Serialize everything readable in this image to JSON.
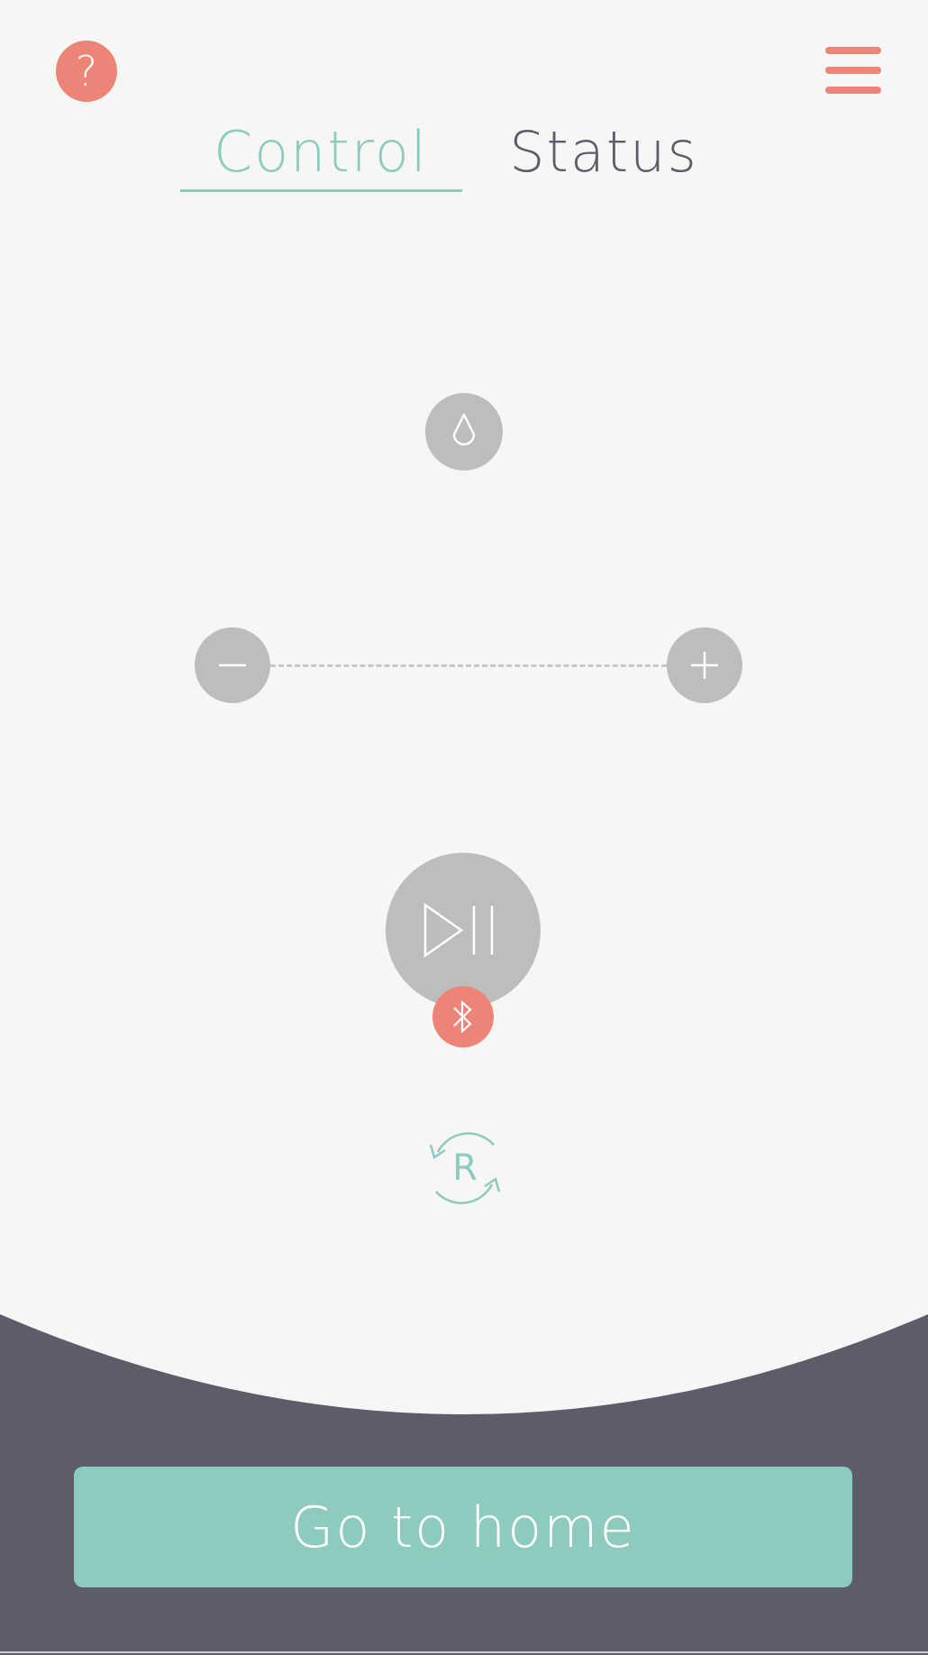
{
  "header": {
    "help_label": "?",
    "help_icon": "question-icon",
    "menu_icon": "hamburger-menu-icon"
  },
  "tabs": [
    {
      "label": "Control",
      "active": true
    },
    {
      "label": "Status",
      "active": false
    }
  ],
  "controls": {
    "drop_icon": "water-drop-icon",
    "decrease_icon": "minus-icon",
    "increase_icon": "plus-icon",
    "play_pause_icon": "play-pause-icon",
    "bluetooth_icon": "bluetooth-icon",
    "reset_label": "R",
    "reset_icon": "refresh-icon"
  },
  "footer": {
    "home_label": "Go to home"
  },
  "colors": {
    "background": "#f6f7f5",
    "accent": "#8ecbbf",
    "coral": "#ec8477",
    "button_gray": "#bdbdbd",
    "footer_dark": "#5e5c6a"
  }
}
